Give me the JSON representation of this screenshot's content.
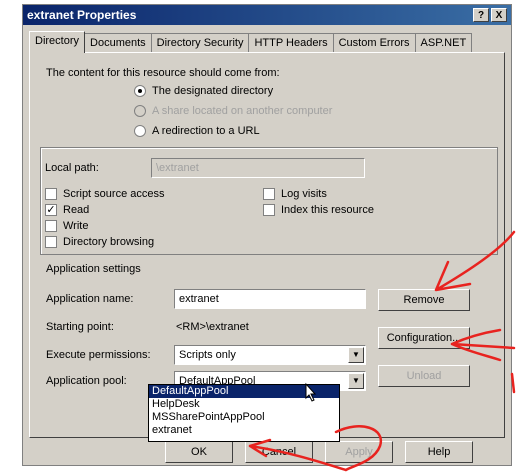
{
  "window": {
    "title": "extranet Properties",
    "help_btn": "?",
    "close_btn": "X"
  },
  "tabs": [
    "Directory",
    "Documents",
    "Directory Security",
    "HTTP Headers",
    "Custom Errors",
    "ASP.NET"
  ],
  "source": {
    "heading": "The content for this resource should come from:",
    "options": [
      {
        "label": "The designated directory",
        "selected": true,
        "enabled": true
      },
      {
        "label": "A share located on another computer",
        "selected": false,
        "enabled": false
      },
      {
        "label": "A redirection to a URL",
        "selected": false,
        "enabled": true
      }
    ]
  },
  "local_path": {
    "label": "Local path:",
    "value": "\\extranet"
  },
  "checks_left": [
    {
      "label": "Script source access",
      "checked": false,
      "mark": ""
    },
    {
      "label": "Read",
      "checked": true,
      "mark": "✓"
    },
    {
      "label": "Write",
      "checked": false,
      "mark": ""
    },
    {
      "label": "Directory browsing",
      "checked": false,
      "mark": ""
    }
  ],
  "checks_right": [
    {
      "label": "Log visits",
      "checked": false,
      "mark": ""
    },
    {
      "label": "Index this resource",
      "checked": false,
      "mark": ""
    }
  ],
  "app": {
    "heading": "Application settings",
    "name_label": "Application name:",
    "name_value": "extranet",
    "start_label": "Starting point:",
    "start_value": "<RM>\\extranet",
    "exec_label": "Execute permissions:",
    "exec_value": "Scripts only",
    "pool_label": "Application pool:",
    "pool_value": "DefaultAppPool",
    "remove_btn": "Remove",
    "config_btn": "Configuration...",
    "unload_btn": "Unload",
    "pool_options": [
      "DefaultAppPool",
      "HelpDesk",
      "MSSharePointAppPool",
      "extranet"
    ]
  },
  "footer": {
    "ok": "OK",
    "cancel": "Cancel",
    "apply": "Apply",
    "help": "Help"
  },
  "colors": {
    "annotation": "#e8231f",
    "title_bar": "#0a246a",
    "selection": "#0a246a"
  }
}
